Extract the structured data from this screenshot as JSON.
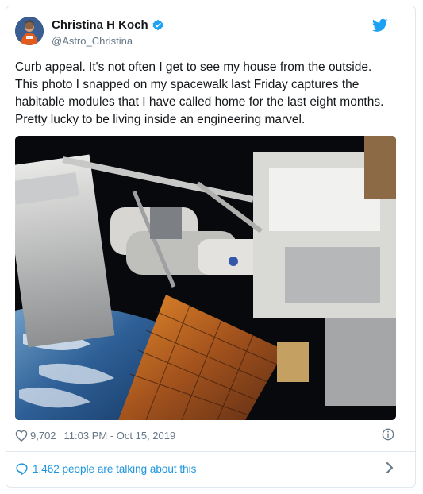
{
  "tweet": {
    "author_name": "Christina H Koch",
    "handle": "@Astro_Christina",
    "text": "Curb appeal. It's not often I get to see my house from the outside.\nThis photo I snapped on my spacewalk last Friday captures the\nhabitable modules that I have called home for the last eight months.\nPretty lucky to be living inside an engineering marvel.",
    "likes": "9,702",
    "timestamp": "11:03 PM - Oct 15, 2019",
    "talking": "1,462 people are talking about this"
  },
  "colors": {
    "accent": "#1da1f2",
    "link": "#1b95e0",
    "muted": "#657786",
    "text": "#14171a",
    "border": "#e1e8ed"
  },
  "icons": {
    "verified": "verified-badge-icon",
    "bird": "twitter-bird-icon",
    "heart": "heart-icon",
    "info": "info-icon",
    "comment": "comment-bubble-icon",
    "chevron": "chevron-right-icon"
  }
}
